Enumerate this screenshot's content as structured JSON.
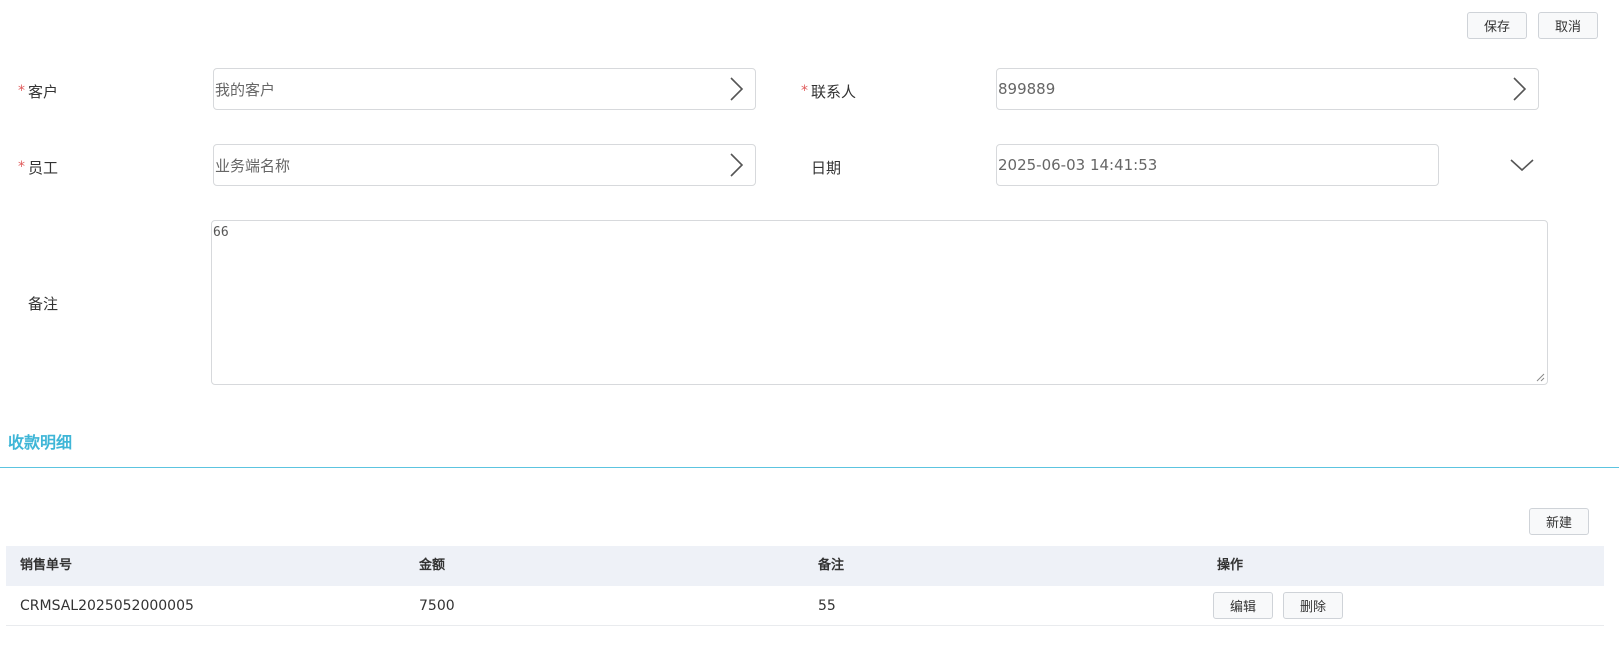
{
  "toolbar": {
    "save_label": "保存",
    "cancel_label": "取消"
  },
  "form": {
    "customer": {
      "label": "客户",
      "required_mark": "*",
      "value": "我的客户"
    },
    "contact": {
      "label": "联系人",
      "required_mark": "*",
      "value": "899889"
    },
    "employee": {
      "label": "员工",
      "required_mark": "*",
      "value": "业务端名称"
    },
    "date": {
      "label": "日期",
      "value": "2025-06-03 14:41:53"
    },
    "remark": {
      "label": "备注",
      "value": "66"
    }
  },
  "section": {
    "title": "收款明细",
    "new_label": "新建"
  },
  "table": {
    "columns": [
      "销售单号",
      "金额",
      "备注",
      "操作"
    ],
    "rows": [
      {
        "order_no": "CRMSAL2025052000005",
        "amount": "7500",
        "remark": "55",
        "edit_label": "编辑",
        "delete_label": "删除"
      }
    ]
  },
  "colors": {
    "accent": "#3fb6d7",
    "required": "#e05a5a",
    "table_header_bg": "#eef1f7"
  }
}
